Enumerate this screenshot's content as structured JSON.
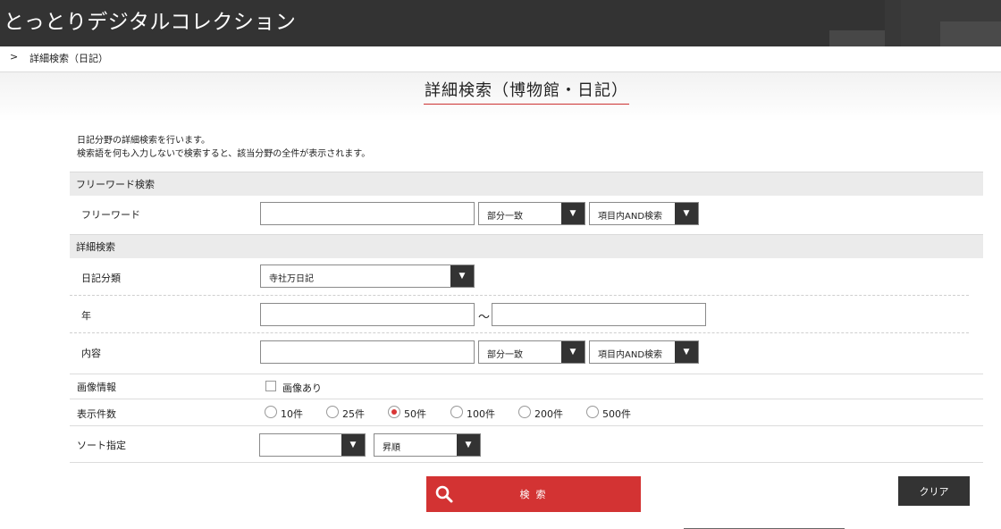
{
  "header": {
    "site_title": "とっとりデジタルコレクション"
  },
  "breadcrumb": {
    "separator": ">",
    "current": "詳細検索（日記）"
  },
  "page": {
    "title": "詳細検索（博物館・日記）",
    "intro_line1": "日記分野の詳細検索を行います。",
    "intro_line2": "検索語を何も入力しないで検索すると、該当分野の全件が表示されます。"
  },
  "freeword_section": {
    "heading": "フリーワード検索",
    "label": "フリーワード",
    "value": "",
    "match_select": "部分一致",
    "logic_select": "項目内AND検索"
  },
  "detail_section": {
    "heading": "詳細検索",
    "category_label": "日記分類",
    "category_select": "寺社万日記",
    "year_label": "年",
    "year_from": "",
    "year_separator": "～",
    "year_to": "",
    "content_label": "内容",
    "content_value": "",
    "content_match_select": "部分一致",
    "content_logic_select": "項目内AND検索"
  },
  "image_info": {
    "label": "画像情報",
    "checkbox_label": "画像あり"
  },
  "display_count": {
    "label": "表示件数",
    "options": [
      "10件",
      "25件",
      "50件",
      "100件",
      "200件",
      "500件"
    ],
    "selected": "50件"
  },
  "sort": {
    "label": "ソート指定",
    "field_select": "",
    "order_select": "昇順"
  },
  "buttons": {
    "search_label": "検 索",
    "clear_label": "クリア"
  },
  "colors": {
    "accent": "#d33333",
    "header_bg": "#333333",
    "dark_button": "#333333"
  }
}
